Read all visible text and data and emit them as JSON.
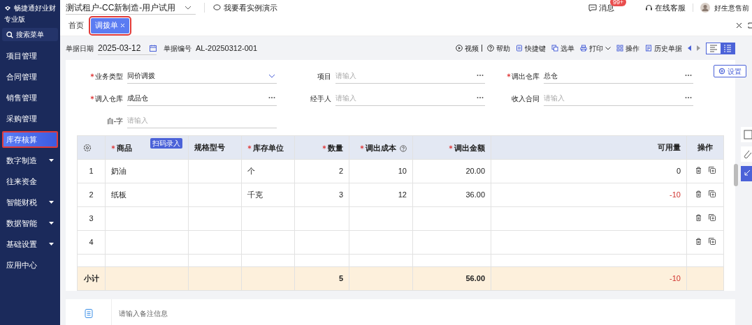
{
  "header": {
    "brand": "畅捷通好业财",
    "edition": "专业版",
    "tenant": "测试租户-CC新制造-用户试用",
    "demo_link": "我要看实例演示",
    "messages": "消息",
    "message_badge": "99+",
    "support": "在线客服",
    "user": "好生意售前"
  },
  "sidebar": {
    "search": "搜索菜单",
    "items": [
      {
        "label": "项目管理",
        "selected": false,
        "expandable": false
      },
      {
        "label": "合同管理",
        "selected": false,
        "expandable": false
      },
      {
        "label": "销售管理",
        "selected": false,
        "expandable": false
      },
      {
        "label": "采购管理",
        "selected": false,
        "expandable": false
      },
      {
        "label": "库存核算",
        "selected": true,
        "expandable": false
      },
      {
        "label": "数字制造",
        "selected": false,
        "expandable": true
      },
      {
        "label": "往来资金",
        "selected": false,
        "expandable": false
      },
      {
        "label": "智能财税",
        "selected": false,
        "expandable": true
      },
      {
        "label": "数据智能",
        "selected": false,
        "expandable": true
      },
      {
        "label": "基础设置",
        "selected": false,
        "expandable": true
      },
      {
        "label": "应用中心",
        "selected": false,
        "expandable": false
      }
    ]
  },
  "tabs": [
    {
      "label": "首页",
      "selected": false,
      "closable": false
    },
    {
      "label": "调拨单",
      "selected": true,
      "closable": true
    }
  ],
  "doc_header": {
    "date_label": "单据日期",
    "date": "2025-03-12",
    "number_label": "单据编号",
    "number": "AL-20250312-001"
  },
  "toolbar": [
    {
      "label": "视频",
      "kind": "video"
    },
    {
      "label": "帮助",
      "kind": "help"
    },
    {
      "label": "快捷键",
      "kind": "keys"
    },
    {
      "label": "选单",
      "kind": "pick"
    },
    {
      "label": "打印",
      "kind": "print"
    },
    {
      "label": "操作",
      "kind": "ops"
    },
    {
      "label": "历史单据",
      "kind": "history"
    }
  ],
  "view_toggle": [
    {
      "kind": "list",
      "selected": false
    },
    {
      "kind": "detail",
      "selected": true
    }
  ],
  "form": {
    "settings": "设置",
    "fields": [
      {
        "label": "业务类型",
        "required": true,
        "value": "同价调拨",
        "kind": "select"
      },
      {
        "label": "项目",
        "required": false,
        "placeholder": "请输入",
        "kind": "lookup"
      },
      {
        "label": "调出仓库",
        "required": true,
        "value": "总仓",
        "kind": "lookup"
      },
      {
        "label": "调入仓库",
        "required": true,
        "value": "成品仓",
        "kind": "lookup"
      },
      {
        "label": "经手人",
        "required": false,
        "placeholder": "请输入",
        "kind": "lookup"
      },
      {
        "label": "收入合同",
        "required": false,
        "placeholder": "请输入",
        "kind": "lookup"
      },
      {
        "label": "自-字",
        "required": false,
        "placeholder": "请输入",
        "kind": "text"
      }
    ]
  },
  "table": {
    "scan_button": "扫码录入",
    "columns": [
      {
        "label": "商品",
        "required": true,
        "help": false
      },
      {
        "label": "规格型号",
        "required": false,
        "help": false
      },
      {
        "label": "库存单位",
        "required": true,
        "help": false
      },
      {
        "label": "数量",
        "required": true,
        "help": false
      },
      {
        "label": "调出成本",
        "required": true,
        "help": true
      },
      {
        "label": "调出金额",
        "required": true,
        "help": false
      },
      {
        "label": "可用量",
        "required": false,
        "help": false
      },
      {
        "label": "操作",
        "required": false,
        "help": false
      }
    ],
    "rows": [
      {
        "index": "1",
        "product": "奶油",
        "unit": "个",
        "quantity": "2",
        "cost": "10",
        "amount": "20.00",
        "available": "0",
        "shortage": false
      },
      {
        "index": "2",
        "product": "纸板",
        "unit": "千克",
        "quantity": "3",
        "cost": "12",
        "amount": "36.00",
        "available": "-10",
        "shortage": true
      },
      {
        "index": "3"
      },
      {
        "index": "4"
      }
    ],
    "subtotal": {
      "label": "小计",
      "quantity": "5",
      "amount": "56.00",
      "available": "-10",
      "shortage": true
    }
  },
  "remarks": {
    "placeholder": "请输入备注信息"
  }
}
